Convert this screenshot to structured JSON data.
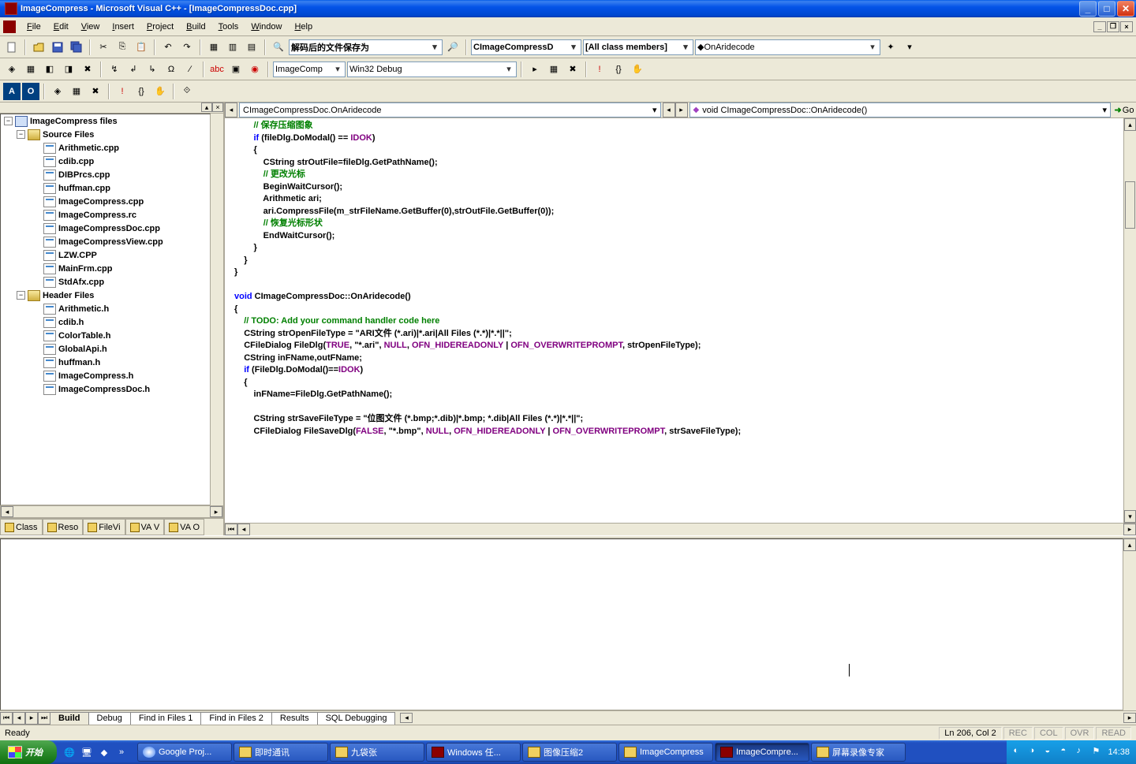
{
  "window": {
    "title": "ImageCompress - Microsoft Visual C++ - [ImageCompressDoc.cpp]"
  },
  "menu": {
    "file": "File",
    "edit": "Edit",
    "view": "View",
    "insert": "Insert",
    "project": "Project",
    "build": "Build",
    "tools": "Tools",
    "window": "Window",
    "help": "Help"
  },
  "toolbar1": {
    "find_combo": "解码后的文件保存为",
    "class_combo": "CImageCompressD",
    "members_combo": "[All class members]",
    "func_combo": "OnAridecode"
  },
  "toolbar2": {
    "project_combo": "ImageComp",
    "config_combo": "Win32 Debug"
  },
  "nav": {
    "left": "CImageCompressDoc.OnAridecode",
    "right": "void CImageCompressDoc::OnAridecode()",
    "go": "Go"
  },
  "tree": {
    "root": "ImageCompress files",
    "source_folder": "Source Files",
    "header_folder": "Header Files",
    "source_files": [
      "Arithmetic.cpp",
      "cdib.cpp",
      "DIBPrcs.cpp",
      "huffman.cpp",
      "ImageCompress.cpp",
      "ImageCompress.rc",
      "ImageCompressDoc.cpp",
      "ImageCompressView.cpp",
      "LZW.CPP",
      "MainFrm.cpp",
      "StdAfx.cpp"
    ],
    "header_files": [
      "Arithmetic.h",
      "cdib.h",
      "ColorTable.h",
      "GlobalApi.h",
      "huffman.h",
      "ImageCompress.h",
      "ImageCompressDoc.h"
    ]
  },
  "sidebar_tabs": [
    "Class",
    "Reso",
    "FileVi",
    "VA V",
    "VA O"
  ],
  "code_lines": [
    {
      "indent": 2,
      "tokens": [
        {
          "t": "cm",
          "v": "// 保存压缩图象"
        }
      ]
    },
    {
      "indent": 2,
      "tokens": [
        {
          "t": "kw",
          "v": "if"
        },
        {
          "t": "",
          "v": " (fileDlg.DoModal() == "
        },
        {
          "t": "mac",
          "v": "IDOK"
        },
        {
          "t": "",
          "v": ")"
        }
      ]
    },
    {
      "indent": 2,
      "tokens": [
        {
          "t": "",
          "v": "{"
        }
      ]
    },
    {
      "indent": 3,
      "tokens": [
        {
          "t": "",
          "v": "CString strOutFile=fileDlg.GetPathName();"
        }
      ]
    },
    {
      "indent": 3,
      "tokens": [
        {
          "t": "cm",
          "v": "// 更改光标"
        }
      ]
    },
    {
      "indent": 3,
      "tokens": [
        {
          "t": "",
          "v": "BeginWaitCursor();"
        }
      ]
    },
    {
      "indent": 3,
      "tokens": [
        {
          "t": "",
          "v": "Arithmetic ari;"
        }
      ]
    },
    {
      "indent": 3,
      "tokens": [
        {
          "t": "",
          "v": "ari.CompressFile(m_strFileName.GetBuffer(0),strOutFile.GetBuffer(0));"
        }
      ]
    },
    {
      "indent": 3,
      "tokens": [
        {
          "t": "cm",
          "v": "// 恢复光标形状"
        }
      ]
    },
    {
      "indent": 3,
      "tokens": [
        {
          "t": "",
          "v": "EndWaitCursor();"
        }
      ]
    },
    {
      "indent": 2,
      "tokens": [
        {
          "t": "",
          "v": "}"
        }
      ]
    },
    {
      "indent": 1,
      "tokens": [
        {
          "t": "",
          "v": "}"
        }
      ]
    },
    {
      "indent": 0,
      "tokens": [
        {
          "t": "",
          "v": "}"
        }
      ]
    },
    {
      "indent": 0,
      "tokens": []
    },
    {
      "indent": 0,
      "tokens": [
        {
          "t": "kw",
          "v": "void"
        },
        {
          "t": "",
          "v": " CImageCompressDoc::OnAridecode()"
        }
      ]
    },
    {
      "indent": 0,
      "tokens": [
        {
          "t": "",
          "v": "{"
        }
      ]
    },
    {
      "indent": 1,
      "tokens": [
        {
          "t": "cm",
          "v": "// TODO: Add your command handler code here"
        }
      ]
    },
    {
      "indent": 1,
      "tokens": [
        {
          "t": "",
          "v": "CString strOpenFileType = "
        },
        {
          "t": "str",
          "v": "\"ARI文件 (*.ari)|*.ari|All Files (*.*)|*.*||\""
        },
        {
          "t": "",
          "v": ";"
        }
      ]
    },
    {
      "indent": 1,
      "tokens": [
        {
          "t": "",
          "v": "CFileDialog FileDlg("
        },
        {
          "t": "mac",
          "v": "TRUE"
        },
        {
          "t": "",
          "v": ", "
        },
        {
          "t": "str",
          "v": "\"*.ari\""
        },
        {
          "t": "",
          "v": ", "
        },
        {
          "t": "mac",
          "v": "NULL"
        },
        {
          "t": "",
          "v": ", "
        },
        {
          "t": "mac",
          "v": "OFN_HIDEREADONLY"
        },
        {
          "t": "",
          "v": " | "
        },
        {
          "t": "mac",
          "v": "OFN_OVERWRITEPROMPT"
        },
        {
          "t": "",
          "v": ", strOpenFileType);"
        }
      ]
    },
    {
      "indent": 1,
      "tokens": [
        {
          "t": "",
          "v": "CString inFName,outFName;"
        }
      ]
    },
    {
      "indent": 1,
      "tokens": [
        {
          "t": "kw",
          "v": "if"
        },
        {
          "t": "",
          "v": " (FileDlg.DoModal()=="
        },
        {
          "t": "mac",
          "v": "IDOK"
        },
        {
          "t": "",
          "v": ")"
        }
      ]
    },
    {
      "indent": 1,
      "tokens": [
        {
          "t": "",
          "v": "{"
        }
      ]
    },
    {
      "indent": 2,
      "tokens": [
        {
          "t": "",
          "v": "inFName=FileDlg.GetPathName();"
        }
      ]
    },
    {
      "indent": 0,
      "tokens": []
    },
    {
      "indent": 2,
      "tokens": [
        {
          "t": "",
          "v": "CString strSaveFileType = "
        },
        {
          "t": "str",
          "v": "\"位图文件 (*.bmp;*.dib)|*.bmp; *.dib|All Files (*.*)|*.*||\""
        },
        {
          "t": "",
          "v": ";"
        }
      ]
    },
    {
      "indent": 2,
      "tokens": [
        {
          "t": "",
          "v": "CFileDialog FileSaveDlg("
        },
        {
          "t": "mac",
          "v": "FALSE"
        },
        {
          "t": "",
          "v": ", "
        },
        {
          "t": "str",
          "v": "\"*.bmp\""
        },
        {
          "t": "",
          "v": ", "
        },
        {
          "t": "mac",
          "v": "NULL"
        },
        {
          "t": "",
          "v": ", "
        },
        {
          "t": "mac",
          "v": "OFN_HIDEREADONLY"
        },
        {
          "t": "",
          "v": " | "
        },
        {
          "t": "mac",
          "v": "OFN_OVERWRITEPROMPT"
        },
        {
          "t": "",
          "v": ", strSaveFileType);"
        }
      ]
    }
  ],
  "output_tabs": [
    "Build",
    "Debug",
    "Find in Files 1",
    "Find in Files 2",
    "Results",
    "SQL Debugging"
  ],
  "status": {
    "main": "Ready",
    "pos": "Ln 206, Col 2",
    "rec": "REC",
    "col": "COL",
    "ovr": "OVR",
    "read": "READ"
  },
  "taskbar": {
    "start": "开始",
    "items": [
      {
        "label": "Google Proj...",
        "icon": "g"
      },
      {
        "label": "即时通讯",
        "icon": "folder"
      },
      {
        "label": "九袋张",
        "icon": "folder"
      },
      {
        "label": "Windows 任...",
        "icon": "app"
      },
      {
        "label": "图像压缩2",
        "icon": "folder"
      },
      {
        "label": "ImageCompress",
        "icon": "folder"
      },
      {
        "label": "ImageCompre...",
        "icon": "app",
        "active": true
      },
      {
        "label": "屏幕录像专家",
        "icon": "folder"
      }
    ],
    "clock": "14:38"
  }
}
